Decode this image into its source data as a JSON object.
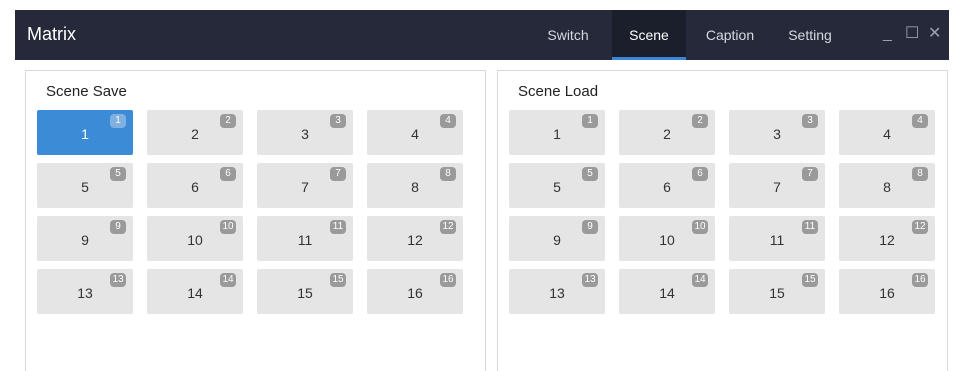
{
  "window": {
    "title": "Matrix"
  },
  "tabs": [
    {
      "label": "Switch",
      "active": false
    },
    {
      "label": "Scene",
      "active": true
    },
    {
      "label": "Caption",
      "active": false
    },
    {
      "label": "Setting",
      "active": false
    }
  ],
  "window_controls": {
    "minimize": "_",
    "maximize": "☐",
    "close": "✕"
  },
  "scene_save": {
    "title": "Scene Save",
    "selected": "1",
    "buttons": [
      {
        "label": "1",
        "badge": "1"
      },
      {
        "label": "2",
        "badge": "2"
      },
      {
        "label": "3",
        "badge": "3"
      },
      {
        "label": "4",
        "badge": "4"
      },
      {
        "label": "5",
        "badge": "5"
      },
      {
        "label": "6",
        "badge": "6"
      },
      {
        "label": "7",
        "badge": "7"
      },
      {
        "label": "8",
        "badge": "8"
      },
      {
        "label": "9",
        "badge": "9"
      },
      {
        "label": "10",
        "badge": "10"
      },
      {
        "label": "11",
        "badge": "11"
      },
      {
        "label": "12",
        "badge": "12"
      },
      {
        "label": "13",
        "badge": "13"
      },
      {
        "label": "14",
        "badge": "14"
      },
      {
        "label": "15",
        "badge": "15"
      },
      {
        "label": "16",
        "badge": "16"
      }
    ]
  },
  "scene_load": {
    "title": "Scene Load",
    "buttons": [
      {
        "label": "1",
        "badge": "1"
      },
      {
        "label": "2",
        "badge": "2"
      },
      {
        "label": "3",
        "badge": "3"
      },
      {
        "label": "4",
        "badge": "4"
      },
      {
        "label": "5",
        "badge": "5"
      },
      {
        "label": "6",
        "badge": "6"
      },
      {
        "label": "7",
        "badge": "7"
      },
      {
        "label": "8",
        "badge": "8"
      },
      {
        "label": "9",
        "badge": "9"
      },
      {
        "label": "10",
        "badge": "10"
      },
      {
        "label": "11",
        "badge": "11"
      },
      {
        "label": "12",
        "badge": "12"
      },
      {
        "label": "13",
        "badge": "13"
      },
      {
        "label": "14",
        "badge": "14"
      },
      {
        "label": "15",
        "badge": "15"
      },
      {
        "label": "16",
        "badge": "16"
      }
    ]
  },
  "colors": {
    "titlebar": "#25293a",
    "accent": "#3b8bd6",
    "button": "#e5e5e5",
    "badge": "#9a9a9a"
  }
}
